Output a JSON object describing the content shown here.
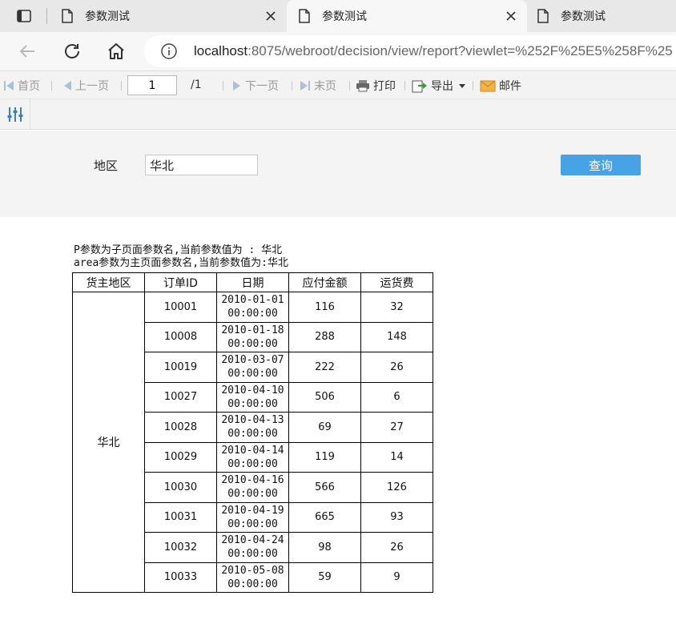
{
  "tabs": [
    {
      "title": "参数测试",
      "active": false
    },
    {
      "title": "参数测试",
      "active": true
    },
    {
      "title": "参数测试",
      "active": false
    }
  ],
  "address": {
    "host": "localhost",
    "path": ":8075/webroot/decision/view/report?viewlet=%252F%25E5%258F%25"
  },
  "toolbar": {
    "first": "首页",
    "prev": "上一页",
    "page_value": "1",
    "page_total": "/1",
    "next": "下一页",
    "last": "末页",
    "print": "打印",
    "export": "导出",
    "mail": "邮件"
  },
  "params": {
    "region_label": "地区",
    "region_value": "华北",
    "query_button": "查询"
  },
  "report": {
    "line1": "P参数为子页面参数名,当前参数值为 : 华北",
    "line2": "area参数为主页面参数名,当前参数值为:华北",
    "headers": [
      "货主地区",
      "订单ID",
      "日期",
      "应付金额",
      "运货费"
    ],
    "region": "华北",
    "rows": [
      {
        "id": "10001",
        "date": "2010-01-01",
        "time": "00:00:00",
        "amount": "116",
        "freight": "32"
      },
      {
        "id": "10008",
        "date": "2010-01-18",
        "time": "00:00:00",
        "amount": "288",
        "freight": "148"
      },
      {
        "id": "10019",
        "date": "2010-03-07",
        "time": "00:00:00",
        "amount": "222",
        "freight": "26"
      },
      {
        "id": "10027",
        "date": "2010-04-10",
        "time": "00:00:00",
        "amount": "506",
        "freight": "6"
      },
      {
        "id": "10028",
        "date": "2010-04-13",
        "time": "00:00:00",
        "amount": "69",
        "freight": "27"
      },
      {
        "id": "10029",
        "date": "2010-04-14",
        "time": "00:00:00",
        "amount": "119",
        "freight": "14"
      },
      {
        "id": "10030",
        "date": "2010-04-16",
        "time": "00:00:00",
        "amount": "566",
        "freight": "126"
      },
      {
        "id": "10031",
        "date": "2010-04-19",
        "time": "00:00:00",
        "amount": "665",
        "freight": "93"
      },
      {
        "id": "10032",
        "date": "2010-04-24",
        "time": "00:00:00",
        "amount": "98",
        "freight": "26"
      },
      {
        "id": "10033",
        "date": "2010-05-08",
        "time": "00:00:00",
        "amount": "59",
        "freight": "9"
      }
    ]
  }
}
